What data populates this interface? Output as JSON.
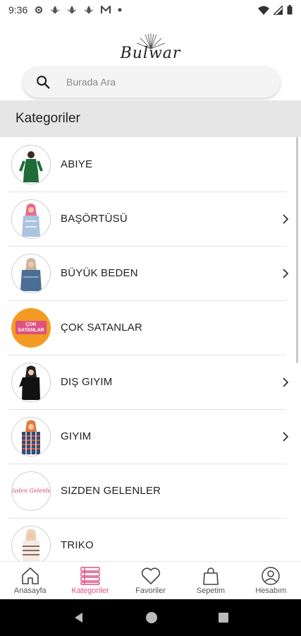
{
  "status_bar": {
    "time": "9:36"
  },
  "brand": {
    "name": "Bulwar"
  },
  "search": {
    "placeholder": "Burada Ara"
  },
  "section": {
    "title": "Kategoriler"
  },
  "categories": [
    {
      "label": "ABIYE",
      "has_children": false
    },
    {
      "label": "BAŞÖRTÜSÜ",
      "has_children": true
    },
    {
      "label": "BÜYÜK BEDEN",
      "has_children": true
    },
    {
      "label": "ÇOK SATANLAR",
      "has_children": false,
      "thumb_text": "ÇOK SATANLAR"
    },
    {
      "label": "DIŞ GIYIM",
      "has_children": true
    },
    {
      "label": "GIYIM",
      "has_children": true
    },
    {
      "label": "SIZDEN GELENLER",
      "has_children": false,
      "thumb_text": "Sizden Gelenler"
    },
    {
      "label": "TRIKO",
      "has_children": false
    }
  ],
  "bottom_nav": [
    {
      "label": "Anasayfa",
      "icon": "home-icon"
    },
    {
      "label": "Kategoriler",
      "icon": "categories-icon",
      "active": true
    },
    {
      "label": "Favoriler",
      "icon": "heart-icon"
    },
    {
      "label": "Sepetim",
      "icon": "bag-icon"
    },
    {
      "label": "Hesabım",
      "icon": "account-icon"
    }
  ],
  "colors": {
    "accent": "#e05080",
    "orange": "#f39a22",
    "section_bg": "#e6e6e6"
  }
}
